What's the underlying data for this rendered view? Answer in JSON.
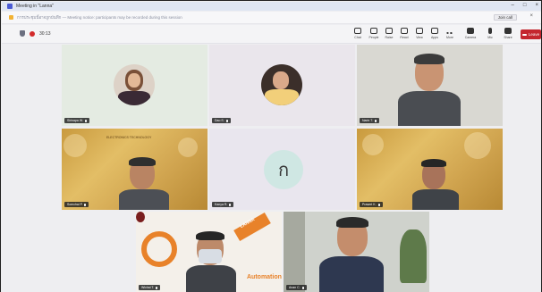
{
  "window": {
    "title": "Meeting in \"Lanna\""
  },
  "banner": {
    "text": "การประชุมนี้อาจถูกบันทึก — Meeting notice: participants may be recorded during this session",
    "join_label": "Join call"
  },
  "toolbar": {
    "timer": "30:13",
    "items": [
      {
        "icon": "chat-icon",
        "label": "Chat"
      },
      {
        "icon": "people-icon",
        "label": "People"
      },
      {
        "icon": "hand-icon",
        "label": "Raise"
      },
      {
        "icon": "react-icon",
        "label": "React"
      },
      {
        "icon": "view-icon",
        "label": "View"
      },
      {
        "icon": "apps-icon",
        "label": "Apps"
      },
      {
        "icon": "more-icon",
        "label": "More"
      },
      {
        "icon": "camera-icon",
        "label": "Camera"
      },
      {
        "icon": "mic-icon",
        "label": "Mic"
      },
      {
        "icon": "share-icon",
        "label": "Share"
      }
    ],
    "leave_label": "Leave"
  },
  "participants": [
    {
      "name": "Sirinapa W.",
      "type": "avatar"
    },
    {
      "name": "Dao S.",
      "type": "avatar"
    },
    {
      "name": "Narin T.",
      "type": "video"
    },
    {
      "name": "Somchai P.",
      "type": "video"
    },
    {
      "name": "Kanya R.",
      "type": "initial",
      "initial": "ก"
    },
    {
      "name": "Prasert K.",
      "type": "video"
    },
    {
      "name": "Wichai T.",
      "type": "video"
    },
    {
      "name": "Anan C.",
      "type": "video"
    }
  ],
  "logos": {
    "lanna": "LANNA",
    "automation": "Automation",
    "banner_title": "ELECTRONICS TECHNOLOGY"
  },
  "colors": {
    "leave": "#c4262e",
    "gold": "#d4a850",
    "tile_bg": "#e9eee7"
  }
}
